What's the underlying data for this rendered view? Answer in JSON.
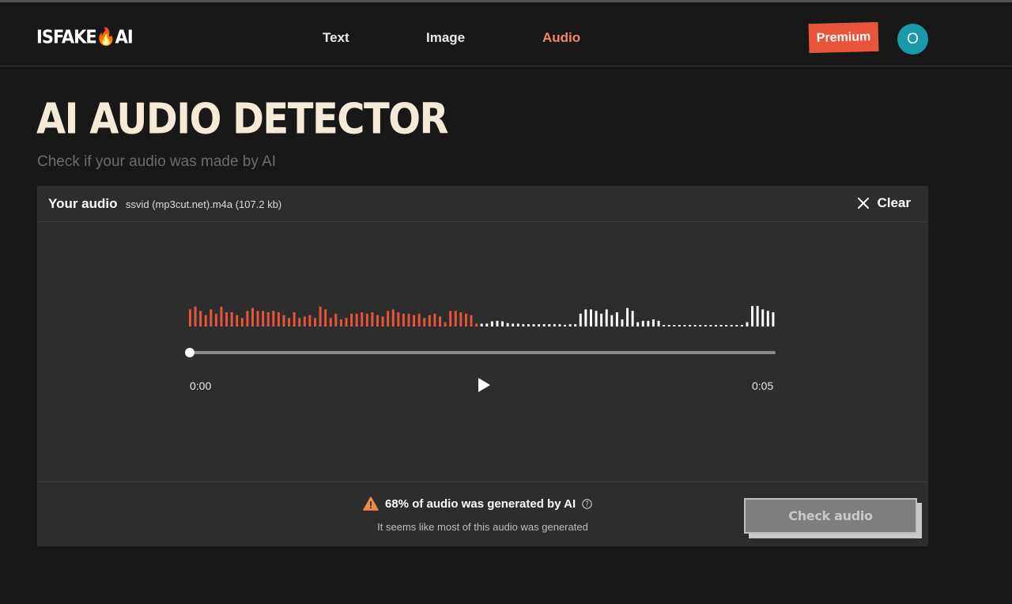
{
  "brand": {
    "logo": "ISFAKEAI"
  },
  "nav": {
    "text": "Text",
    "image": "Image",
    "audio": "Audio",
    "active": "Audio"
  },
  "header": {
    "premium": "Premium",
    "avatar_initial": "O"
  },
  "page": {
    "title": "AI AUDIO DETECTOR",
    "subtitle": "Check if your audio was made by AI"
  },
  "upload": {
    "label": "Your audio",
    "file": "ssvid (mp3cut.net).m4a (107.2 kb)",
    "clear": "Clear"
  },
  "player": {
    "current_time": "0:00",
    "duration": "0:05",
    "progress": 0,
    "waveform_colors": {
      "played_ai": "#e8553a",
      "rest": "#ffffff"
    },
    "waveform_levels": [
      0.6,
      0.7,
      0.55,
      0.4,
      0.6,
      0.45,
      0.7,
      0.5,
      0.5,
      0.4,
      0.3,
      0.55,
      0.65,
      0.55,
      0.55,
      0.5,
      0.55,
      0.5,
      0.4,
      0.3,
      0.5,
      0.3,
      0.35,
      0.4,
      0.3,
      0.7,
      0.6,
      0.3,
      0.45,
      0.25,
      0.3,
      0.45,
      0.45,
      0.5,
      0.45,
      0.5,
      0.4,
      0.35,
      0.55,
      0.6,
      0.5,
      0.45,
      0.45,
      0.4,
      0.45,
      0.3,
      0.4,
      0.45,
      0.35,
      0.15,
      0.55,
      0.55,
      0.5,
      0.45,
      0.4,
      0.1,
      0.1,
      0.1,
      0.18,
      0.2,
      0.18,
      0.12,
      0.1,
      0.1,
      0.08,
      0.08,
      0.08,
      0.08,
      0.08,
      0.08,
      0.08,
      0.08,
      0.06,
      0.08,
      0.08,
      0.45,
      0.6,
      0.6,
      0.55,
      0.45,
      0.6,
      0.4,
      0.5,
      0.25,
      0.65,
      0.55,
      0.15,
      0.2,
      0.2,
      0.25,
      0.2,
      0.05,
      0.05,
      0.05,
      0.05,
      0.05,
      0.05,
      0.05,
      0.05,
      0.05,
      0.05,
      0.05,
      0.05,
      0.05,
      0.05,
      0.05,
      0.05,
      0.15,
      0.72,
      0.72,
      0.6,
      0.55,
      0.5
    ],
    "ai_bar_count": 56
  },
  "result": {
    "headline": "68% of audio was generated by AI",
    "ai_percent": 68,
    "sub": "It seems like most of this audio was generated",
    "check_button": "Check audio"
  },
  "colors": {
    "accent": "#e8553a",
    "nav_active": "#f2895c",
    "avatar": "#1a9aa8",
    "title": "#f4ead7",
    "warning": "#f08a4b"
  }
}
